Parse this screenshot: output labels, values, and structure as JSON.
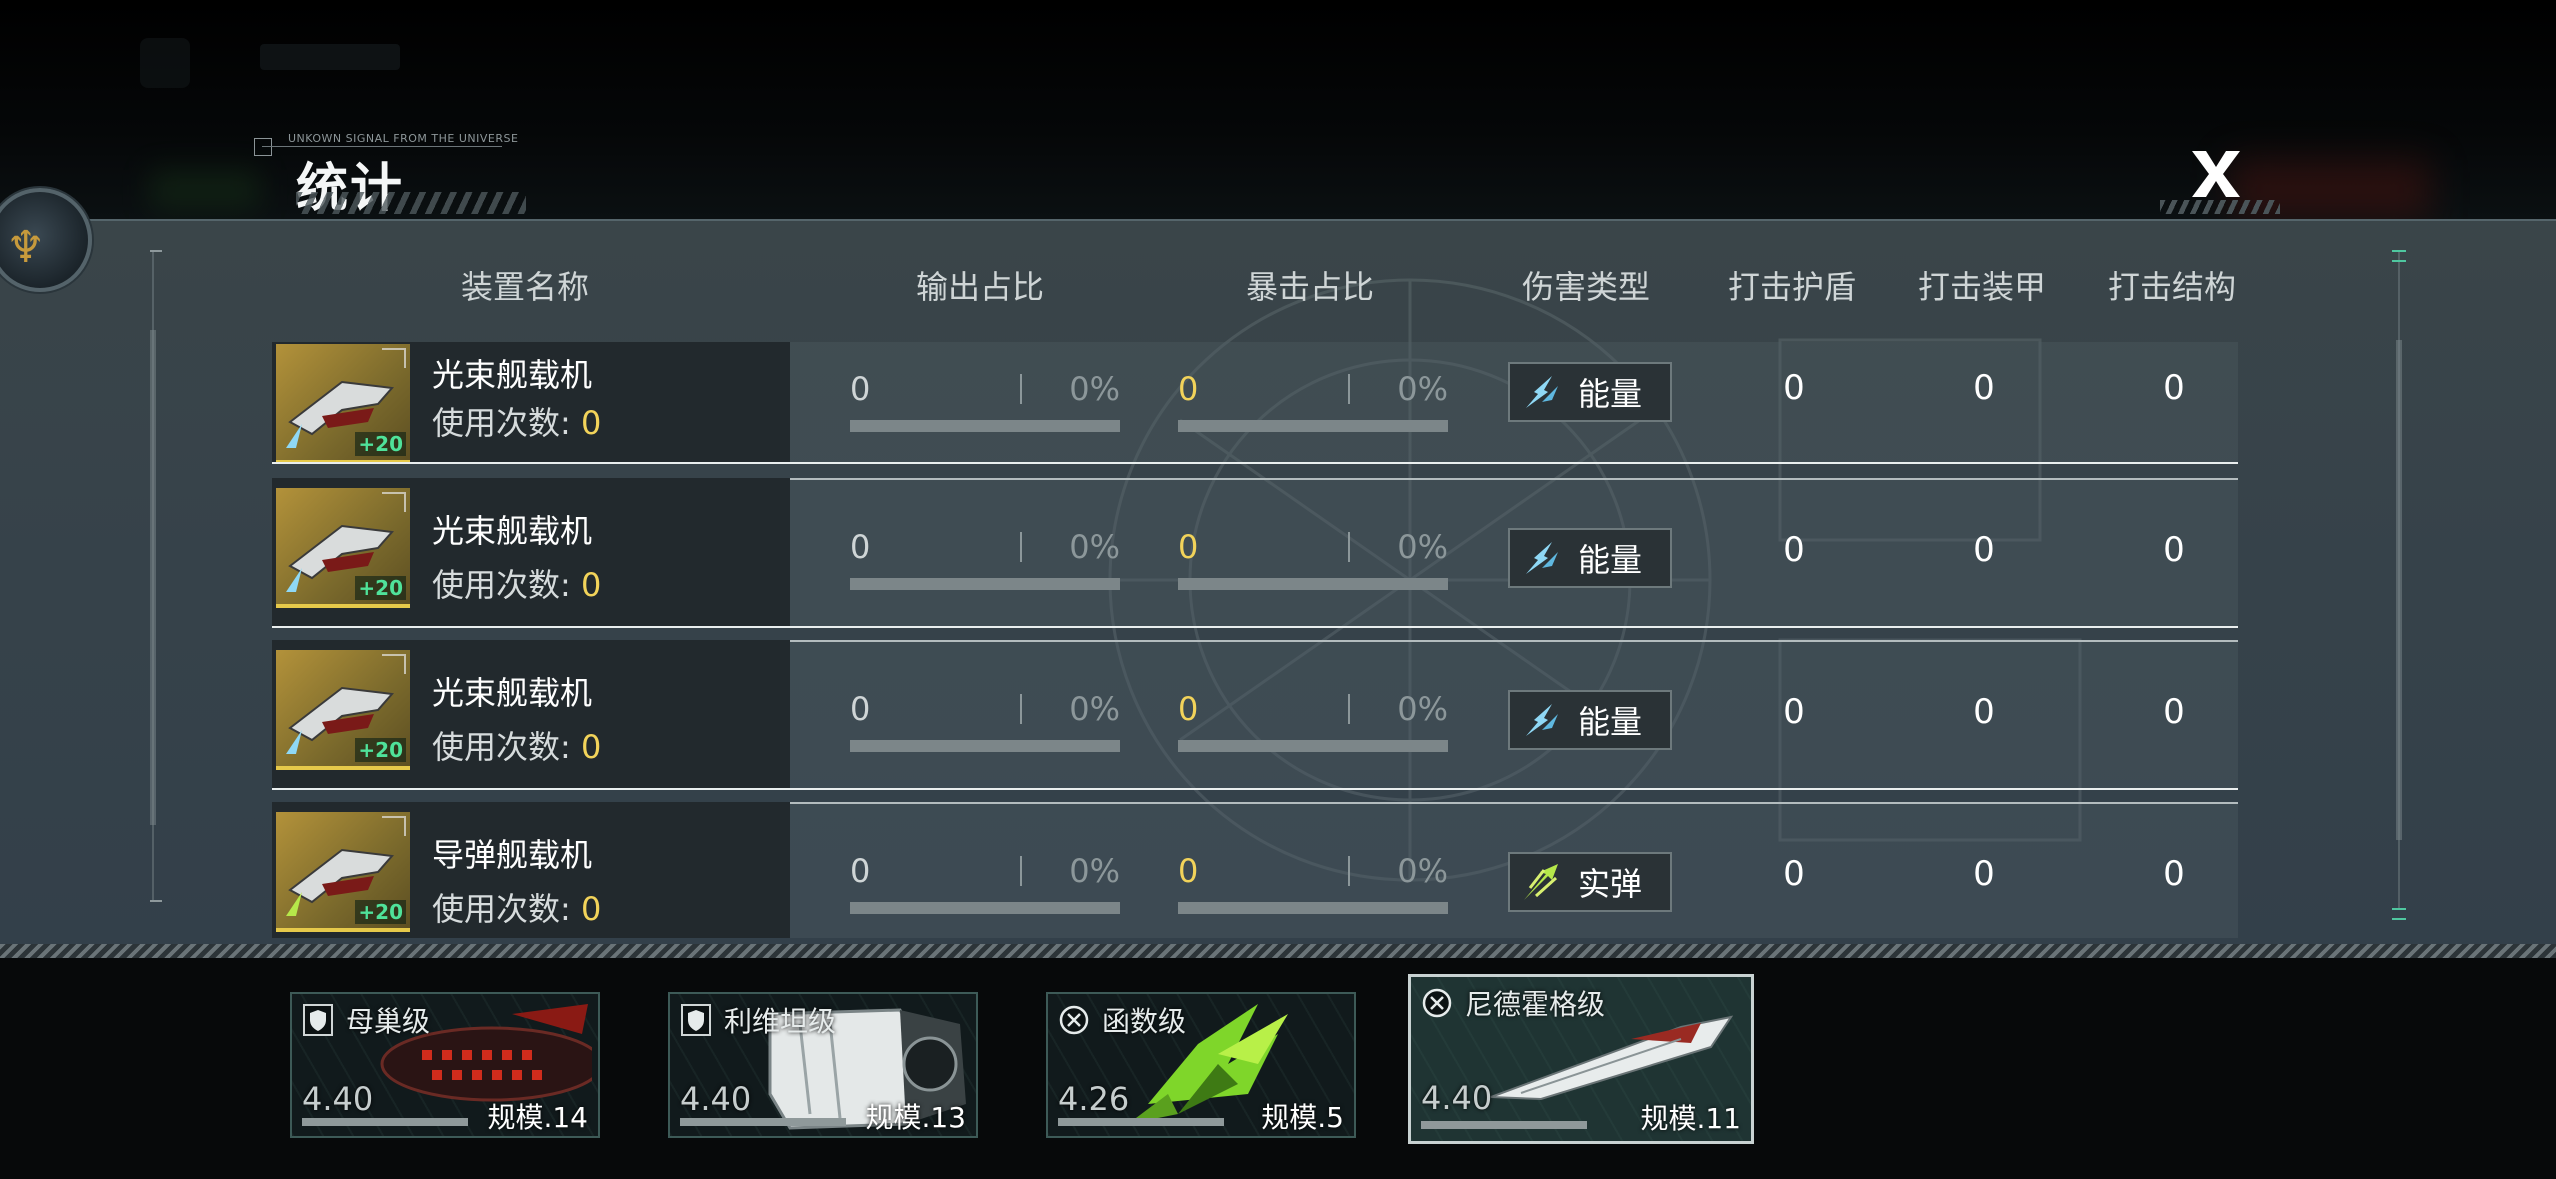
{
  "header": {
    "title": "统计",
    "signal_text": "UNKOWN SIGNAL FROM THE UNIVERSE"
  },
  "columns": [
    "装置名称",
    "输出占比",
    "暴击占比",
    "伤害类型",
    "打击护盾",
    "打击装甲",
    "打击结构"
  ],
  "use_count_label": "使用次数: ",
  "rows": [
    {
      "name": "光束舰载机",
      "uses": "0",
      "plus": "+20",
      "output_value": "0",
      "output_pct": "0%",
      "crit_value": "0",
      "crit_pct": "0%",
      "damage_type": "能量",
      "damage_icon": "energy-icon",
      "shield_hit": "0",
      "armor_hit": "0",
      "structure_hit": "0"
    },
    {
      "name": "光束舰载机",
      "uses": "0",
      "plus": "+20",
      "output_value": "0",
      "output_pct": "0%",
      "crit_value": "0",
      "crit_pct": "0%",
      "damage_type": "能量",
      "damage_icon": "energy-icon",
      "shield_hit": "0",
      "armor_hit": "0",
      "structure_hit": "0"
    },
    {
      "name": "光束舰载机",
      "uses": "0",
      "plus": "+20",
      "output_value": "0",
      "output_pct": "0%",
      "crit_value": "0",
      "crit_pct": "0%",
      "damage_type": "能量",
      "damage_icon": "energy-icon",
      "shield_hit": "0",
      "armor_hit": "0",
      "structure_hit": "0"
    },
    {
      "name": "导弹舰载机",
      "uses": "0",
      "plus": "+20",
      "output_value": "0",
      "output_pct": "0%",
      "crit_value": "0",
      "crit_pct": "0%",
      "damage_type": "实弹",
      "damage_icon": "kinetic-icon",
      "shield_hit": "0",
      "armor_hit": "0",
      "structure_hit": "0"
    }
  ],
  "ships": [
    {
      "name": "母巢级",
      "rating": "4.40",
      "scale": "规模.14",
      "icon": "shield-icon",
      "active": false
    },
    {
      "name": "利维坦级",
      "rating": "4.40",
      "scale": "规模.13",
      "icon": "shield-icon",
      "active": false
    },
    {
      "name": "函数级",
      "rating": "4.26",
      "scale": "规模.5",
      "icon": "crosshair-icon",
      "active": false
    },
    {
      "name": "尼德霍格级",
      "rating": "4.40",
      "scale": "规模.11",
      "icon": "crosshair-icon",
      "active": true
    }
  ],
  "colors": {
    "accent_yellow": "#f2d35a",
    "accent_green": "#4fe29a",
    "energy_blue": "#8fd8f5",
    "kinetic_green": "#b6e84a",
    "panel_bg": "#36424a"
  }
}
